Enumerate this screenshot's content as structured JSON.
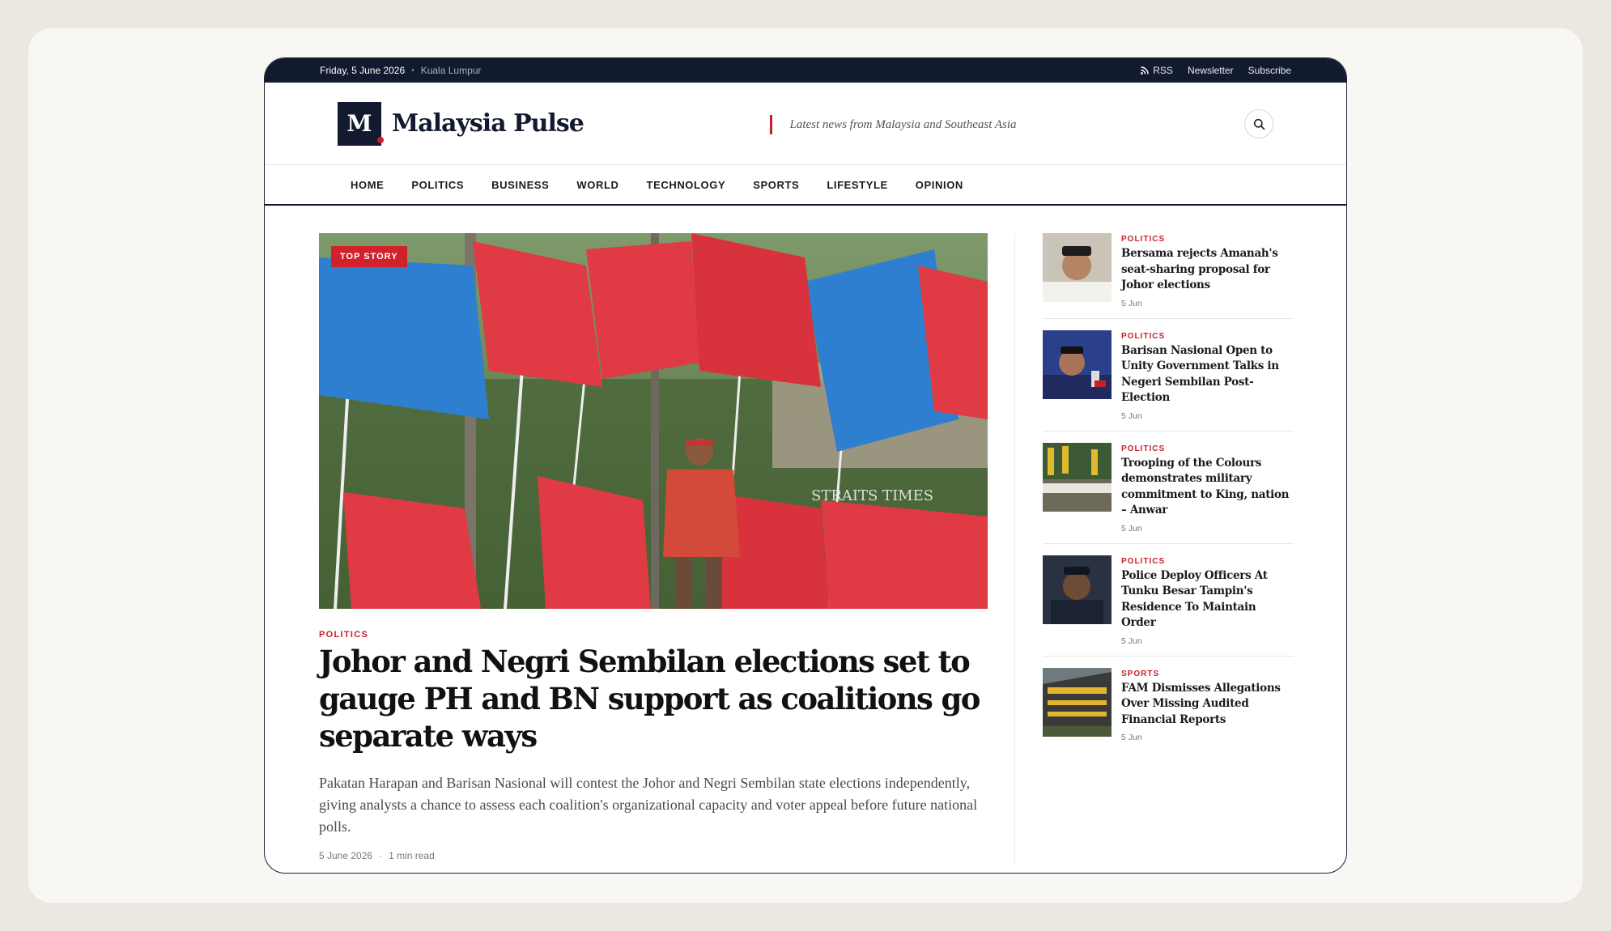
{
  "topbar": {
    "date": "Friday, 5 June 2026",
    "location": "Kuala Lumpur",
    "rss": "RSS",
    "newsletter": "Newsletter",
    "subscribe": "Subscribe"
  },
  "masthead": {
    "logo_letter": "M",
    "brand": "Malaysia Pulse",
    "tagline": "Latest news from Malaysia and Southeast Asia"
  },
  "nav": [
    "HOME",
    "POLITICS",
    "BUSINESS",
    "WORLD",
    "TECHNOLOGY",
    "SPORTS",
    "LIFESTYLE",
    "OPINION"
  ],
  "hero": {
    "badge": "TOP STORY",
    "watermark": "STRAITS TIMES",
    "category": "POLITICS",
    "title": "Johor and Negri Sembilan elections set to gauge PH and BN support as coalitions go separate ways",
    "description": "Pakatan Harapan and Barisan Nasional will contest the Johor and Negri Sembilan state elections independently, giving analysts a chance to assess each coalition's organizational capacity and voter appeal before future national polls.",
    "date": "5 June 2026",
    "read_time": "1 min read"
  },
  "sidebar": [
    {
      "category": "POLITICS",
      "title": "Bersama rejects Amanah's seat-sharing proposal for Johor elections",
      "date": "5 Jun"
    },
    {
      "category": "POLITICS",
      "title": "Barisan Nasional Open to Unity Government Talks in Negeri Sembilan Post-Election",
      "date": "5 Jun"
    },
    {
      "category": "POLITICS",
      "title": "Trooping of the Colours demonstrates military commitment to King, nation – Anwar",
      "date": "5 Jun"
    },
    {
      "category": "POLITICS",
      "title": "Police Deploy Officers At Tunku Besar Tampin's Residence To Maintain Order",
      "date": "5 Jun"
    },
    {
      "category": "SPORTS",
      "title": "FAM Dismisses Allegations Over Missing Audited Financial Reports",
      "date": "5 Jun"
    }
  ],
  "colors": {
    "navy": "#111a2e",
    "accent_red": "#c8202b",
    "ph_red": "#e03a44",
    "bn_blue": "#2f7fd0"
  }
}
